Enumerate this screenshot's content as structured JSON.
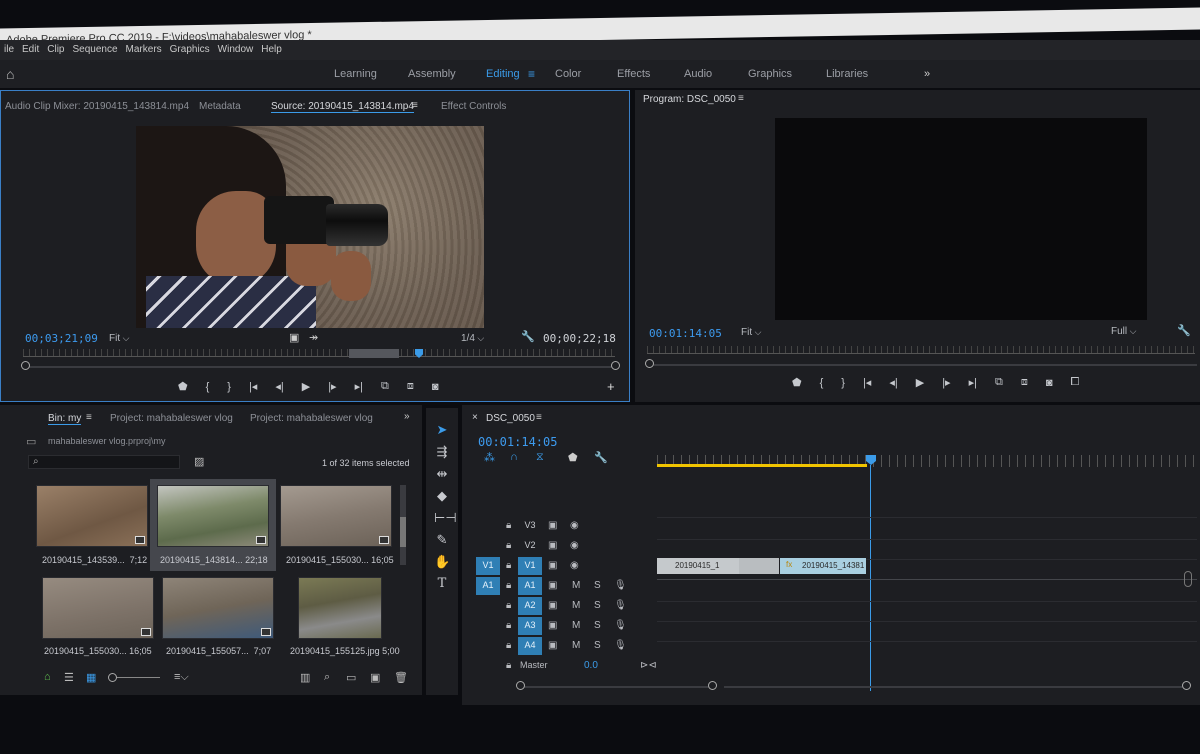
{
  "app": {
    "title": "Adobe Premiere Pro CC 2019 - F:\\videos\\mahabaleswer vlog *",
    "menu": [
      "ile",
      "Edit",
      "Clip",
      "Sequence",
      "Markers",
      "Graphics",
      "Window",
      "Help"
    ]
  },
  "workspaces": {
    "items": [
      "Learning",
      "Assembly",
      "Editing",
      "Color",
      "Effects",
      "Audio",
      "Graphics",
      "Libraries"
    ],
    "active": "Editing",
    "overflow": "»"
  },
  "source_panel": {
    "tabs": [
      "Audio Clip Mixer: 20190415_143814.mp4",
      "Metadata",
      "Source: 20190415_143814.mp4",
      "Effect Controls"
    ],
    "active_tab": "Source: 20190415_143814.mp4",
    "timecode_current": "00;03;21;09",
    "fit": "Fit",
    "resolution": "1/4",
    "timecode_duration": "00;00;22;18"
  },
  "program_panel": {
    "title": "Program: DSC_0050",
    "timecode_current": "00:01:14:05",
    "fit": "Fit",
    "resolution": "Full"
  },
  "project_panel": {
    "tabs": [
      "Bin: my",
      "Project: mahabaleswer vlog",
      "Project: mahabaleswer vlog"
    ],
    "path": "mahabaleswer vlog.prproj\\my",
    "selection_status": "1 of 32 items selected",
    "items": [
      {
        "name": "20190415_143539...",
        "duration": "7;12",
        "color": "#8a6e55",
        "selected": false
      },
      {
        "name": "20190415_143814...",
        "duration": "22;18",
        "color": "#6f7c5e",
        "selected": true
      },
      {
        "name": "20190415_155030...",
        "duration": "16;05",
        "color": "#7a6e62",
        "selected": false
      },
      {
        "name": "20190415_155030...",
        "duration": "16;05",
        "color": "#857a70",
        "selected": false
      },
      {
        "name": "20190415_155057...",
        "duration": "7;07",
        "color": "#5d6a7a",
        "selected": false
      },
      {
        "name": "20190415_155125.jpg",
        "duration": "5;00",
        "color": "#6b6a4e",
        "selected": false
      }
    ]
  },
  "tools": [
    "selection-tool",
    "track-select-tool",
    "ripple-edit-tool",
    "razor-tool",
    "slip-tool",
    "pen-tool",
    "hand-tool",
    "type-tool"
  ],
  "timeline": {
    "sequence_name": "DSC_0050",
    "timecode": "00:01:14:05",
    "video_tracks": [
      {
        "label": "V3",
        "source": ""
      },
      {
        "label": "V2",
        "source": ""
      },
      {
        "label": "V1",
        "source": "V1"
      }
    ],
    "audio_tracks": [
      {
        "label": "A1",
        "source": "A1"
      },
      {
        "label": "A2",
        "source": ""
      },
      {
        "label": "A3",
        "source": ""
      },
      {
        "label": "A4",
        "source": ""
      }
    ],
    "master_label": "Master",
    "master_value": "0.0",
    "clips": [
      {
        "name": "20190415_1",
        "track": "V1"
      },
      {
        "name": "",
        "track": "V1"
      },
      {
        "name": "20190415_14381",
        "track": "V1"
      }
    ],
    "mute_label": "M",
    "solo_label": "S"
  },
  "colors": {
    "accent": "#3b9be8",
    "track_target": "#2f7fb5",
    "work_area": "#f0c400",
    "panel_bg": "#1d1e22"
  }
}
